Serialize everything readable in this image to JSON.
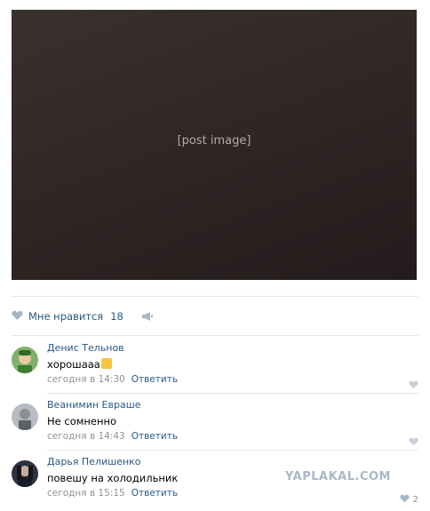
{
  "post": {
    "likes_label": "Мне нравится",
    "likes_count": "18"
  },
  "comments": [
    {
      "author": "Денис Тельнов",
      "text": "хорошааа",
      "time": "сегодня в 14:30",
      "reply": "Ответить",
      "likes": ""
    },
    {
      "author": "Веанимин Евраше",
      "text": "Не сомненно",
      "time": "сегодня в 14:43",
      "reply": "Ответить",
      "likes": ""
    },
    {
      "author": "Дарья Пелишенко",
      "text": "повешу на холодильник",
      "time": "сегодня в 15:15",
      "reply": "Ответить",
      "likes": "2"
    }
  ],
  "watermark": "YAPLAKAL.COM",
  "colors": {
    "link": "#2a5885",
    "meta": "#939393",
    "divider": "#e7e8ec"
  }
}
